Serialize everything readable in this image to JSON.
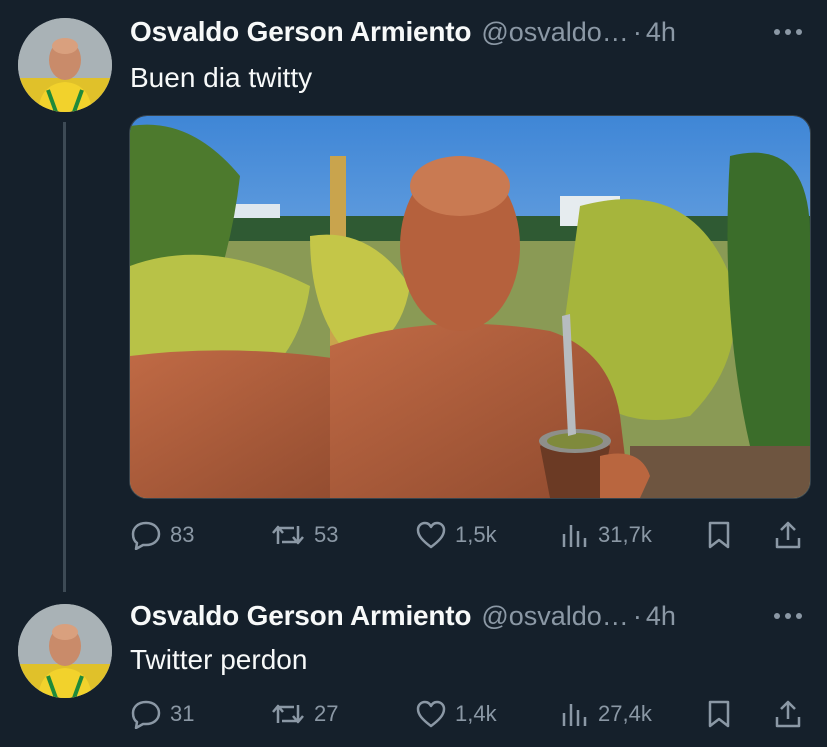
{
  "tweets": [
    {
      "author_name": "Osvaldo Gerson Armiento",
      "handle": "@osvaldo…",
      "separator": "·",
      "time": "4h",
      "text": "Buen dia twitty",
      "has_media": true,
      "metrics": {
        "replies": "83",
        "reposts": "53",
        "likes": "1,5k",
        "views": "31,7k"
      }
    },
    {
      "author_name": "Osvaldo Gerson Armiento",
      "handle": "@osvaldo…",
      "separator": "·",
      "time": "4h",
      "text": "Twitter perdon",
      "has_media": false,
      "metrics": {
        "replies": "31",
        "reposts": "27",
        "likes": "1,4k",
        "views": "27,4k"
      }
    }
  ],
  "colors": {
    "background": "#15202b",
    "text": "#f7f9f9",
    "muted": "#8b98a5",
    "thread_line": "#3d4a55"
  },
  "icons": [
    "more-icon",
    "reply-icon",
    "repost-icon",
    "like-icon",
    "views-icon",
    "bookmark-icon",
    "share-icon"
  ]
}
